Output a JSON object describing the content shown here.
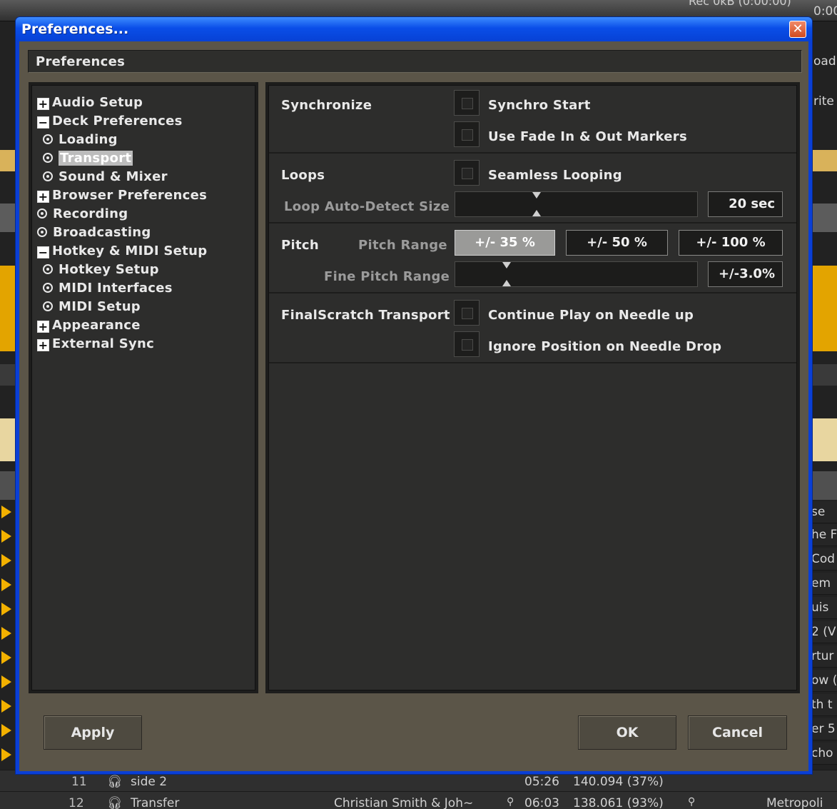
{
  "dialog": {
    "title": "Preferences...",
    "close_glyph": "✕",
    "header": "Preferences"
  },
  "tree": [
    {
      "label": "Audio Setup",
      "expander": "+"
    },
    {
      "label": "Deck Preferences",
      "expander": "−"
    },
    {
      "label": "Loading"
    },
    {
      "label": "Transport",
      "selected": true
    },
    {
      "label": "Sound & Mixer"
    },
    {
      "label": "Browser Preferences",
      "expander": "+"
    },
    {
      "label": "Recording"
    },
    {
      "label": "Broadcasting"
    },
    {
      "label": "Hotkey & MIDI Setup",
      "expander": "−"
    },
    {
      "label": "Hotkey Setup"
    },
    {
      "label": "MIDI Interfaces"
    },
    {
      "label": "MIDI Setup"
    },
    {
      "label": "Appearance",
      "expander": "+"
    },
    {
      "label": "External Sync",
      "expander": "+"
    }
  ],
  "sync": {
    "title": "Synchronize",
    "synchro_start": "Synchro Start",
    "fade_markers": "Use Fade In & Out Markers"
  },
  "loops": {
    "title": "Loops",
    "seamless": "Seamless Looping",
    "auto_detect_label": "Loop Auto-Detect Size",
    "auto_detect_value": "20 sec",
    "auto_detect_level": 0.33
  },
  "pitch": {
    "title": "Pitch",
    "range_label": "Pitch Range",
    "ranges": [
      "+/- 35 %",
      "+/- 50 %",
      "+/- 100 %"
    ],
    "active_range": "+/- 35 %",
    "fine_label": "Fine Pitch Range",
    "fine_value": "+/-3.0%",
    "fine_level": 0.2
  },
  "finalscratch": {
    "title": "FinalScratch Transport",
    "continue_play": "Continue Play on Needle up",
    "ignore_position": "Ignore Position on Needle Drop"
  },
  "buttons": {
    "apply": "Apply",
    "ok": "OK",
    "cancel": "Cancel"
  },
  "background": {
    "top_time": "0:00",
    "top_right": "Rec 0kB (0:00:00)",
    "side_labels": [
      "oad",
      "rite"
    ],
    "right_column": [
      "se",
      "he F",
      "Cod",
      "em",
      "uis",
      "2 (V",
      "rtur",
      "ow (",
      "th t",
      "er 5",
      "cho"
    ],
    "rows": [
      {
        "num": "11",
        "title": "side 2",
        "artist": "",
        "time": "05:26",
        "bpm": "140.094 (37%)",
        "label": ""
      },
      {
        "num": "12",
        "title": "Transfer",
        "artist": "Christian Smith & Joh~",
        "time": "06:03",
        "bpm": "138.061 (93%)",
        "label": "Metropoli"
      }
    ]
  }
}
